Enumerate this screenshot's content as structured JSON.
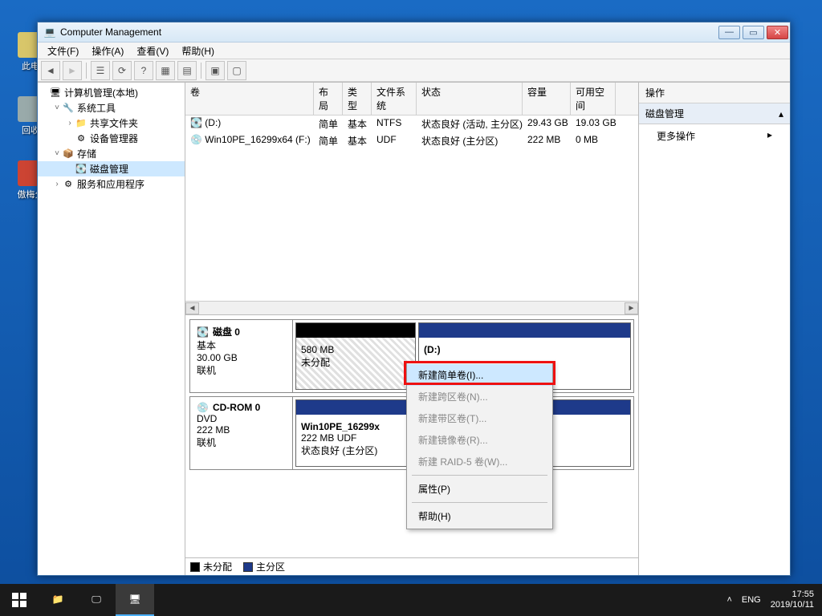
{
  "desktop": {
    "icon1": "此电",
    "icon2": "回收",
    "icon3": "傲梅分"
  },
  "window": {
    "title": "Computer Management"
  },
  "menu": {
    "file": "文件(F)",
    "action": "操作(A)",
    "view": "查看(V)",
    "help": "帮助(H)"
  },
  "tree": {
    "root": "计算机管理(本地)",
    "systools": "系统工具",
    "shared": "共享文件夹",
    "devmgr": "设备管理器",
    "storage": "存储",
    "diskmgmt": "磁盘管理",
    "services": "服务和应用程序"
  },
  "cols": {
    "vol": "卷",
    "layout": "布局",
    "type": "类型",
    "fs": "文件系统",
    "status": "状态",
    "cap": "容量",
    "free": "可用空间"
  },
  "vols": [
    {
      "name": "(D:)",
      "layout": "简单",
      "type": "基本",
      "fs": "NTFS",
      "status": "状态良好 (活动, 主分区)",
      "cap": "29.43 GB",
      "free": "19.03 GB"
    },
    {
      "name": "Win10PE_16299x64 (F:)",
      "layout": "简单",
      "type": "基本",
      "fs": "UDF",
      "status": "状态良好 (主分区)",
      "cap": "222 MB",
      "free": "0 MB"
    }
  ],
  "disk0": {
    "title": "磁盘 0",
    "type": "基本",
    "size": "30.00 GB",
    "state": "联机",
    "part1_size": "580 MB",
    "part1_label": "未分配",
    "part2_label": "(D:)"
  },
  "cdrom": {
    "title": "CD-ROM 0",
    "type": "DVD",
    "size": "222 MB",
    "state": "联机",
    "p_name": "Win10PE_16299x",
    "p_size": "222 MB UDF",
    "p_status": "状态良好 (主分区)"
  },
  "legend": {
    "unalloc": "未分配",
    "primary": "主分区"
  },
  "actions": {
    "head": "操作",
    "section": "磁盘管理",
    "more": "更多操作"
  },
  "ctx": {
    "simple": "新建简单卷(I)...",
    "spanned": "新建跨区卷(N)...",
    "striped": "新建带区卷(T)...",
    "mirror": "新建镜像卷(R)...",
    "raid5": "新建 RAID-5 卷(W)...",
    "props": "属性(P)",
    "help": "帮助(H)"
  },
  "taskbar": {
    "ime": "ENG",
    "time": "17:55",
    "date": "2019/10/11"
  }
}
